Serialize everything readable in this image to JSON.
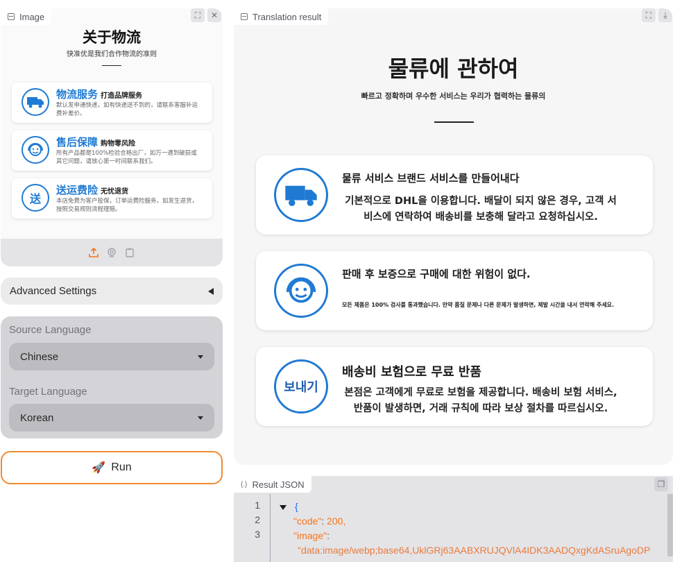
{
  "image_panel": {
    "tag": "Image",
    "source": {
      "title": "关于物流",
      "subtitle": "快准优是我们合作物流的准则",
      "cards": [
        {
          "icon": "truck-icon",
          "heading": "物流服务",
          "tagline": "打造品牌服务",
          "text": "默认发申通快递，如有快递送不到的，请联系客服补运费补差价。"
        },
        {
          "icon": "headset-icon",
          "heading": "售后保障",
          "tagline": "购物零风险",
          "text": "所有产品都是100%检验合格出厂，如万一遇到破损或其它问题，请放心第一时间联系我们。"
        },
        {
          "icon": "send-icon",
          "icon_text": "送",
          "heading": "送运费险",
          "tagline": "无忧退货",
          "text": "本店免费为客户投保，订单运费险服务，如发生退货，按照交易规则流程理赔。"
        }
      ]
    }
  },
  "advanced_settings": {
    "label": "Advanced Settings"
  },
  "language": {
    "source_label": "Source Language",
    "source_value": "Chinese",
    "target_label": "Target Language",
    "target_value": "Korean"
  },
  "run": {
    "icon": "🚀",
    "label": "Run"
  },
  "result_panel": {
    "tag": "Translation result",
    "translated": {
      "title": "물류에 관하여",
      "subtitle": "빠르고 정확하며 우수한 서비스는 우리가 협력하는 물류의",
      "cards": [
        {
          "icon": "truck-icon",
          "heading": "물류 서비스 브랜드 서비스를 만들어내다",
          "text": "기본적으로 DHL을 이용합니다. 배달이 되지 않은 경우, 고객 서비스에 연락하여 배송비를 보충해 달라고 요청하십시오."
        },
        {
          "icon": "headset-icon",
          "heading": "판매 후 보증으로 구매에 대한 위험이 없다.",
          "text": "모든 제품은 100% 검사를 통과했습니다. 만약 품질 문제나 다른 문제가 발생하면, 제발 시간을 내서 연락해 주세요."
        },
        {
          "icon": "send-icon",
          "icon_text": "보내기",
          "heading": "배송비 보험으로 무료 반품",
          "text": "본점은 고객에게 무료로 보험을 제공합니다. 배송비 보험 서비스, 반품이 발생하면, 거래 규칙에 따라 보상 절차를 따르십시오."
        }
      ]
    }
  },
  "json_panel": {
    "tag": "Result JSON",
    "line_numbers": [
      "1",
      "2",
      "3"
    ],
    "open_brace": "{",
    "code_key": "\"code\"",
    "code_value": "200,",
    "image_key": "\"image\"",
    "image_value": "\"data:image/webp;base64,UklGRj63AABXRUJQVlA4IDK3AADQxgKdASruAgoDP"
  }
}
